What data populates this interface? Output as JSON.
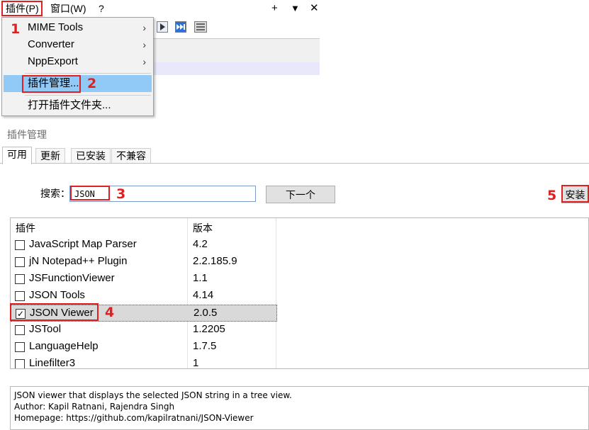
{
  "menubar": {
    "plugins_label": "插件(P)",
    "window_label": "窗口(W)",
    "help_label": "?",
    "add_label": "+",
    "dropdown_label": "▼",
    "close_label": "✕"
  },
  "dropdown": {
    "items": [
      {
        "label": "MIME Tools",
        "arrow": "›"
      },
      {
        "label": "Converter",
        "arrow": "›"
      },
      {
        "label": "NppExport",
        "arrow": "›"
      },
      {
        "label": "插件管理..."
      },
      {
        "label": "打开插件文件夹..."
      }
    ]
  },
  "annotations": [
    "1",
    "2",
    "3",
    "4",
    "5"
  ],
  "plugin_manager": {
    "title": "插件管理",
    "tabs": [
      {
        "label": "可用"
      },
      {
        "label": "更新"
      },
      {
        "label": "已安装"
      },
      {
        "label": "不兼容"
      }
    ],
    "search": {
      "label": "搜索：",
      "value": "JSON"
    },
    "next_label": "下一个",
    "install_label": "安装",
    "list": {
      "headers": {
        "plugin": "插件",
        "version": "版本"
      },
      "rows": [
        {
          "name": "JavaScript Map Parser",
          "version": "4.2",
          "checked": false
        },
        {
          "name": "jN Notepad++ Plugin",
          "version": "2.2.185.9",
          "checked": false
        },
        {
          "name": "JSFunctionViewer",
          "version": "1.1",
          "checked": false
        },
        {
          "name": "JSON Tools",
          "version": "4.14",
          "checked": false
        },
        {
          "name": "JSON Viewer",
          "version": "2.0.5",
          "checked": true,
          "check_mark": "✓"
        },
        {
          "name": "JSTool",
          "version": "1.2205",
          "checked": false
        },
        {
          "name": "LanguageHelp",
          "version": "1.7.5",
          "checked": false
        },
        {
          "name": "Linefilter3",
          "version": "1",
          "checked": false
        }
      ]
    },
    "description": {
      "line1": "JSON viewer that displays the selected JSON string in a tree view.",
      "line2": "Author: Kapil Ratnani, Rajendra Singh",
      "line3": "Homepage: https://github.com/kapilratnani/JSON-Viewer"
    }
  },
  "colors": {
    "annotation": "#e02020",
    "highlight": "#91c9f7",
    "selected_row": "#d9d9d9"
  }
}
